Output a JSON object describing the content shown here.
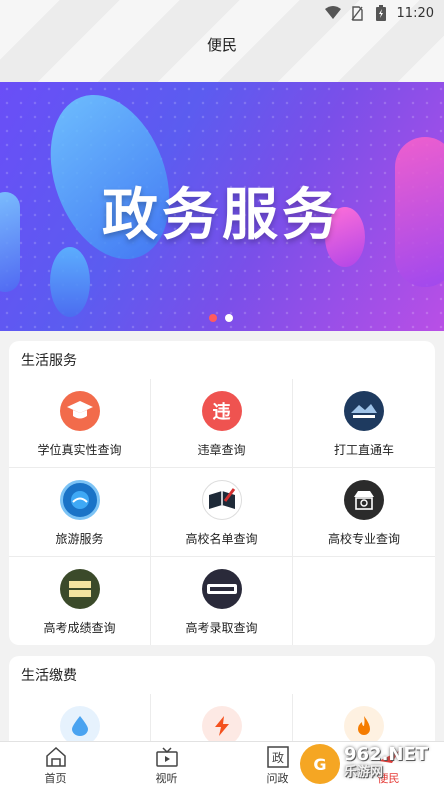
{
  "status_bar": {
    "time": "11:20",
    "icons": [
      "wifi-icon",
      "no-sim-icon",
      "battery-icon"
    ]
  },
  "header": {
    "title": "便民"
  },
  "banner": {
    "title": "政务服务",
    "dots": [
      {
        "active": true
      },
      {
        "active": false
      }
    ]
  },
  "life_services": {
    "title": "生活服务",
    "items": [
      {
        "label": "学位真实性查询",
        "icon": "graduation-cap-icon",
        "color": "#f26b4b"
      },
      {
        "label": "违章查询",
        "icon": "violation-icon",
        "color": "#ef5350"
      },
      {
        "label": "打工直通车",
        "icon": "work-bus-icon",
        "color": "#1e3a5f"
      },
      {
        "label": "旅游服务",
        "icon": "travel-icon",
        "color": "#1a73c7"
      },
      {
        "label": "高校名单查询",
        "icon": "university-list-icon",
        "color": "#1f2a38"
      },
      {
        "label": "高校专业查询",
        "icon": "university-major-icon",
        "color": "#2b2b2b"
      },
      {
        "label": "高考成绩查询",
        "icon": "exam-score-icon",
        "color": "#3b4a2a"
      },
      {
        "label": "高考录取查询",
        "icon": "admission-query-icon",
        "color": "#2a2a3a"
      }
    ]
  },
  "life_payment": {
    "title": "生活缴费",
    "items": [
      {
        "icon": "water-drop-icon",
        "color": "#4aa3f0",
        "bg": "#e6f2fd"
      },
      {
        "icon": "lightning-icon",
        "color": "#f4511e",
        "bg": "#fde9e4"
      },
      {
        "icon": "flame-icon",
        "color": "#f57c00",
        "bg": "#fef1e1"
      }
    ]
  },
  "tabbar": {
    "items": [
      {
        "label": "首页",
        "icon": "home-icon",
        "active": false
      },
      {
        "label": "视听",
        "icon": "tv-icon",
        "active": false
      },
      {
        "label": "问政",
        "icon": "politics-icon",
        "active": false
      },
      {
        "label": "便民",
        "icon": "convenience-icon",
        "active": true
      }
    ]
  },
  "watermark": {
    "number": "962",
    "suffix": ".NET",
    "text": "乐游网"
  },
  "colors": {
    "accent": "#e53935",
    "banner_from": "#6a4ef7",
    "banner_to": "#b94fe6"
  }
}
